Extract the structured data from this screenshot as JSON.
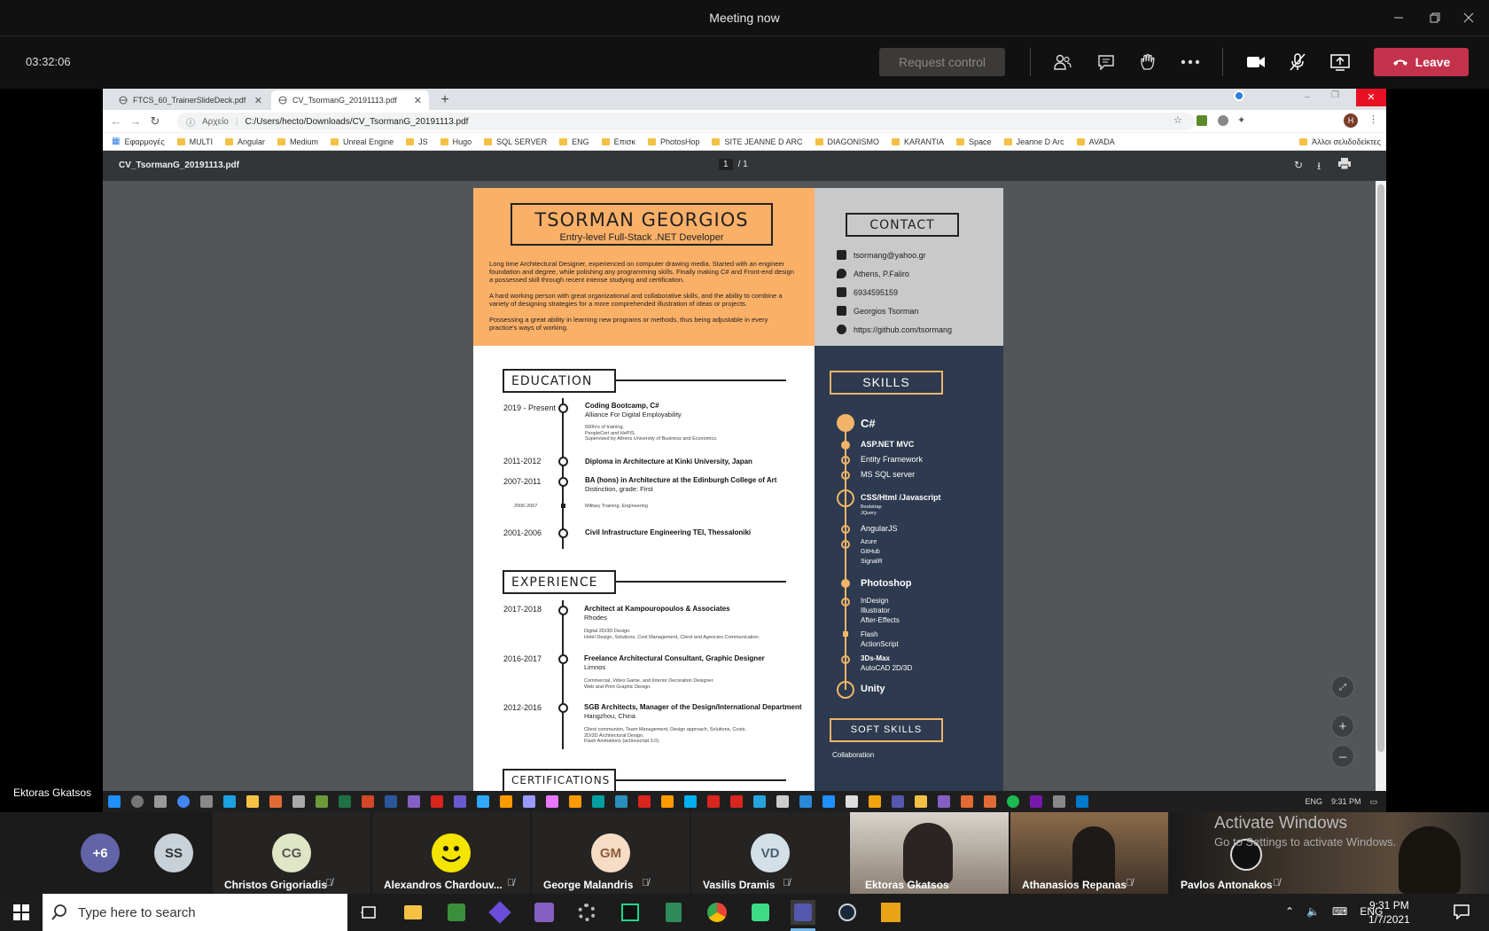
{
  "teams": {
    "meeting_title": "Meeting now",
    "timer": "03:32:06",
    "request_control": "Request control",
    "leave": "Leave",
    "presenter": "Ektoras Gkatsos"
  },
  "browser": {
    "tabs": [
      {
        "label": "FTCS_60_TrainerSlideDeck.pdf"
      },
      {
        "label": "CV_TsormanG_20191113.pdf"
      }
    ],
    "address_prefix": "Αρχείο",
    "address": "C:/Users/hecto/Downloads/CV_TsormanG_20191113.pdf",
    "bookmarks": [
      "Εφαρμογές",
      "MULTI",
      "Angular",
      "Medium",
      "Unreal Engine",
      "JS",
      "Hugo",
      "SQL SERVER",
      "ENG",
      "Επισκ",
      "PhotosHop",
      "SITE JEANNE D ARC",
      "DIAGONISMO",
      "KARANTIA",
      "Space",
      "Jeanne D Arc",
      "AVADA"
    ],
    "other_bookmarks": "Άλλοι σελιδοδείκτες",
    "profile_initial": "H"
  },
  "pdf": {
    "filename": "CV_TsormanG_20191113.pdf",
    "page_current": "1",
    "page_total": "/ 1"
  },
  "cv": {
    "name": "TSORMAN GEORGIOS",
    "role": "Entry-level Full-Stack .NET Developer",
    "para1": "Long time Architectural Designer, experienced on computer drawing media. Started with an engineer foundation and degree, while polishing any programming skills. Finally making C# and Front-end design a possessed skill through recent intense studying and certification.",
    "para2": "A hard working person with great organizational and collaborative skills, and the ability to combine a variety of designing strategies for a more comprehended illustration of ideas or projects.",
    "para3": "Possessing a great ability in learning new programs or methods, thus being adjustable in every practice's ways of working.",
    "contact_heading": "CONTACT",
    "contact": {
      "email": "tsormang@yahoo.gr",
      "location": "Athens, P.Faliro",
      "phone": "6934595159",
      "linkedin": "Georgios Tsorman",
      "github": "https://github.com/tsormang"
    },
    "education_heading": "EDUCATION",
    "education": [
      {
        "year": "2019 - Present",
        "title": "Coding Bootcamp, C#",
        "sub": "Alliance For Digital Employability",
        "small": "500hrs of training.\nPeopleCert and HePIS.\nSupervised by Athens University of Business and Economics."
      },
      {
        "year": "2011-2012",
        "title": "Diploma in Architecture at Kinki University, Japan",
        "sub": "",
        "small": ""
      },
      {
        "year": "2007-2011",
        "title": "BA (hons) in Architecture at the Edinburgh College of Art",
        "sub": "Distinction, grade: First",
        "small": ""
      },
      {
        "year": "2006-2007",
        "title": "Military Training, Engineering",
        "sub": "",
        "small": ""
      },
      {
        "year": "2001-2006",
        "title": "Civil Infrastructure Engineering  TEI, Thessaloniki",
        "sub": "",
        "small": ""
      }
    ],
    "experience_heading": "EXPERIENCE",
    "experience": [
      {
        "year": "2017-2018",
        "title": "Architect at Kampouropoulos & Associates",
        "sub": "Rhodes",
        "small": "Digital 2D/3D Design.\nHotel Design, Solutions, Cost Management, Client and Agencies Communication."
      },
      {
        "year": "2016-2017",
        "title": "Freelance Architectural Consultant, Graphic Designer",
        "sub": "Limnos",
        "small": "Commercial, Video Game, and Interior Decoration Designer.\nWeb and Print Graphic Design."
      },
      {
        "year": "2012-2016",
        "title": "SGB Architects, Manager of the Design/International Department",
        "sub": "Hangzhou, China",
        "small": "Client communion, Team Management, Design approach, Solutions, Costs.\n2D/3D Architectural Design.\nFlash Animations (actionscript 3.0)."
      }
    ],
    "certifications_heading": "CERTIFICATIONS",
    "skills_heading": "SKILLS",
    "skills": {
      "csharp": "C#",
      "aspnet": "ASP.NET MVC",
      "ef": "Entity Framework",
      "mssql": "MS SQL server",
      "css": "CSS/Html /Javascript",
      "bootstrap": "Bootstrap",
      "jquery": "JQuery",
      "angular": "AngularJS",
      "azure": "Azure",
      "github": "GitHub",
      "signalr": "SignalR",
      "photoshop": "Photoshop",
      "indesign": "InDesign",
      "illustrator": "Illustrator",
      "aftereffects": "After-Effects",
      "flash": "Flash",
      "actionscript": "ActionScript",
      "max": "3Ds-Max",
      "autocad": "AutoCAD 2D/3D",
      "unity": "Unity"
    },
    "soft_heading": "SOFT SKILLS",
    "soft1": "Collaboration"
  },
  "inner_taskbar": {
    "lang": "ENG",
    "time": "9:31 PM"
  },
  "participants": [
    {
      "initials": "+6",
      "name": "",
      "color": "#6264a7"
    },
    {
      "initials": "SS",
      "name": "",
      "color": "#c8d1d8"
    },
    {
      "initials": "CG",
      "name": "Christos Grigoriadis",
      "color": "#dfe6c5"
    },
    {
      "initials": "",
      "name": "Alexandros Chardouv...",
      "color": ""
    },
    {
      "initials": "GM",
      "name": "George Malandris",
      "color": "#f6dcc5"
    },
    {
      "initials": "VD",
      "name": "Vasilis Dramis",
      "color": "#d4e0e8"
    }
  ],
  "video_tiles": [
    {
      "name": "Ektoras Gkatsos"
    },
    {
      "name": "Athanasios Repanas"
    },
    {
      "name": "Pavlos Antonakos"
    }
  ],
  "activate": {
    "title": "Activate Windows",
    "sub": "Go to Settings to activate Windows."
  },
  "windows": {
    "search_placeholder": "Type here to search",
    "lang": "ENG",
    "time": "9:31 PM",
    "date": "1/7/2021"
  }
}
